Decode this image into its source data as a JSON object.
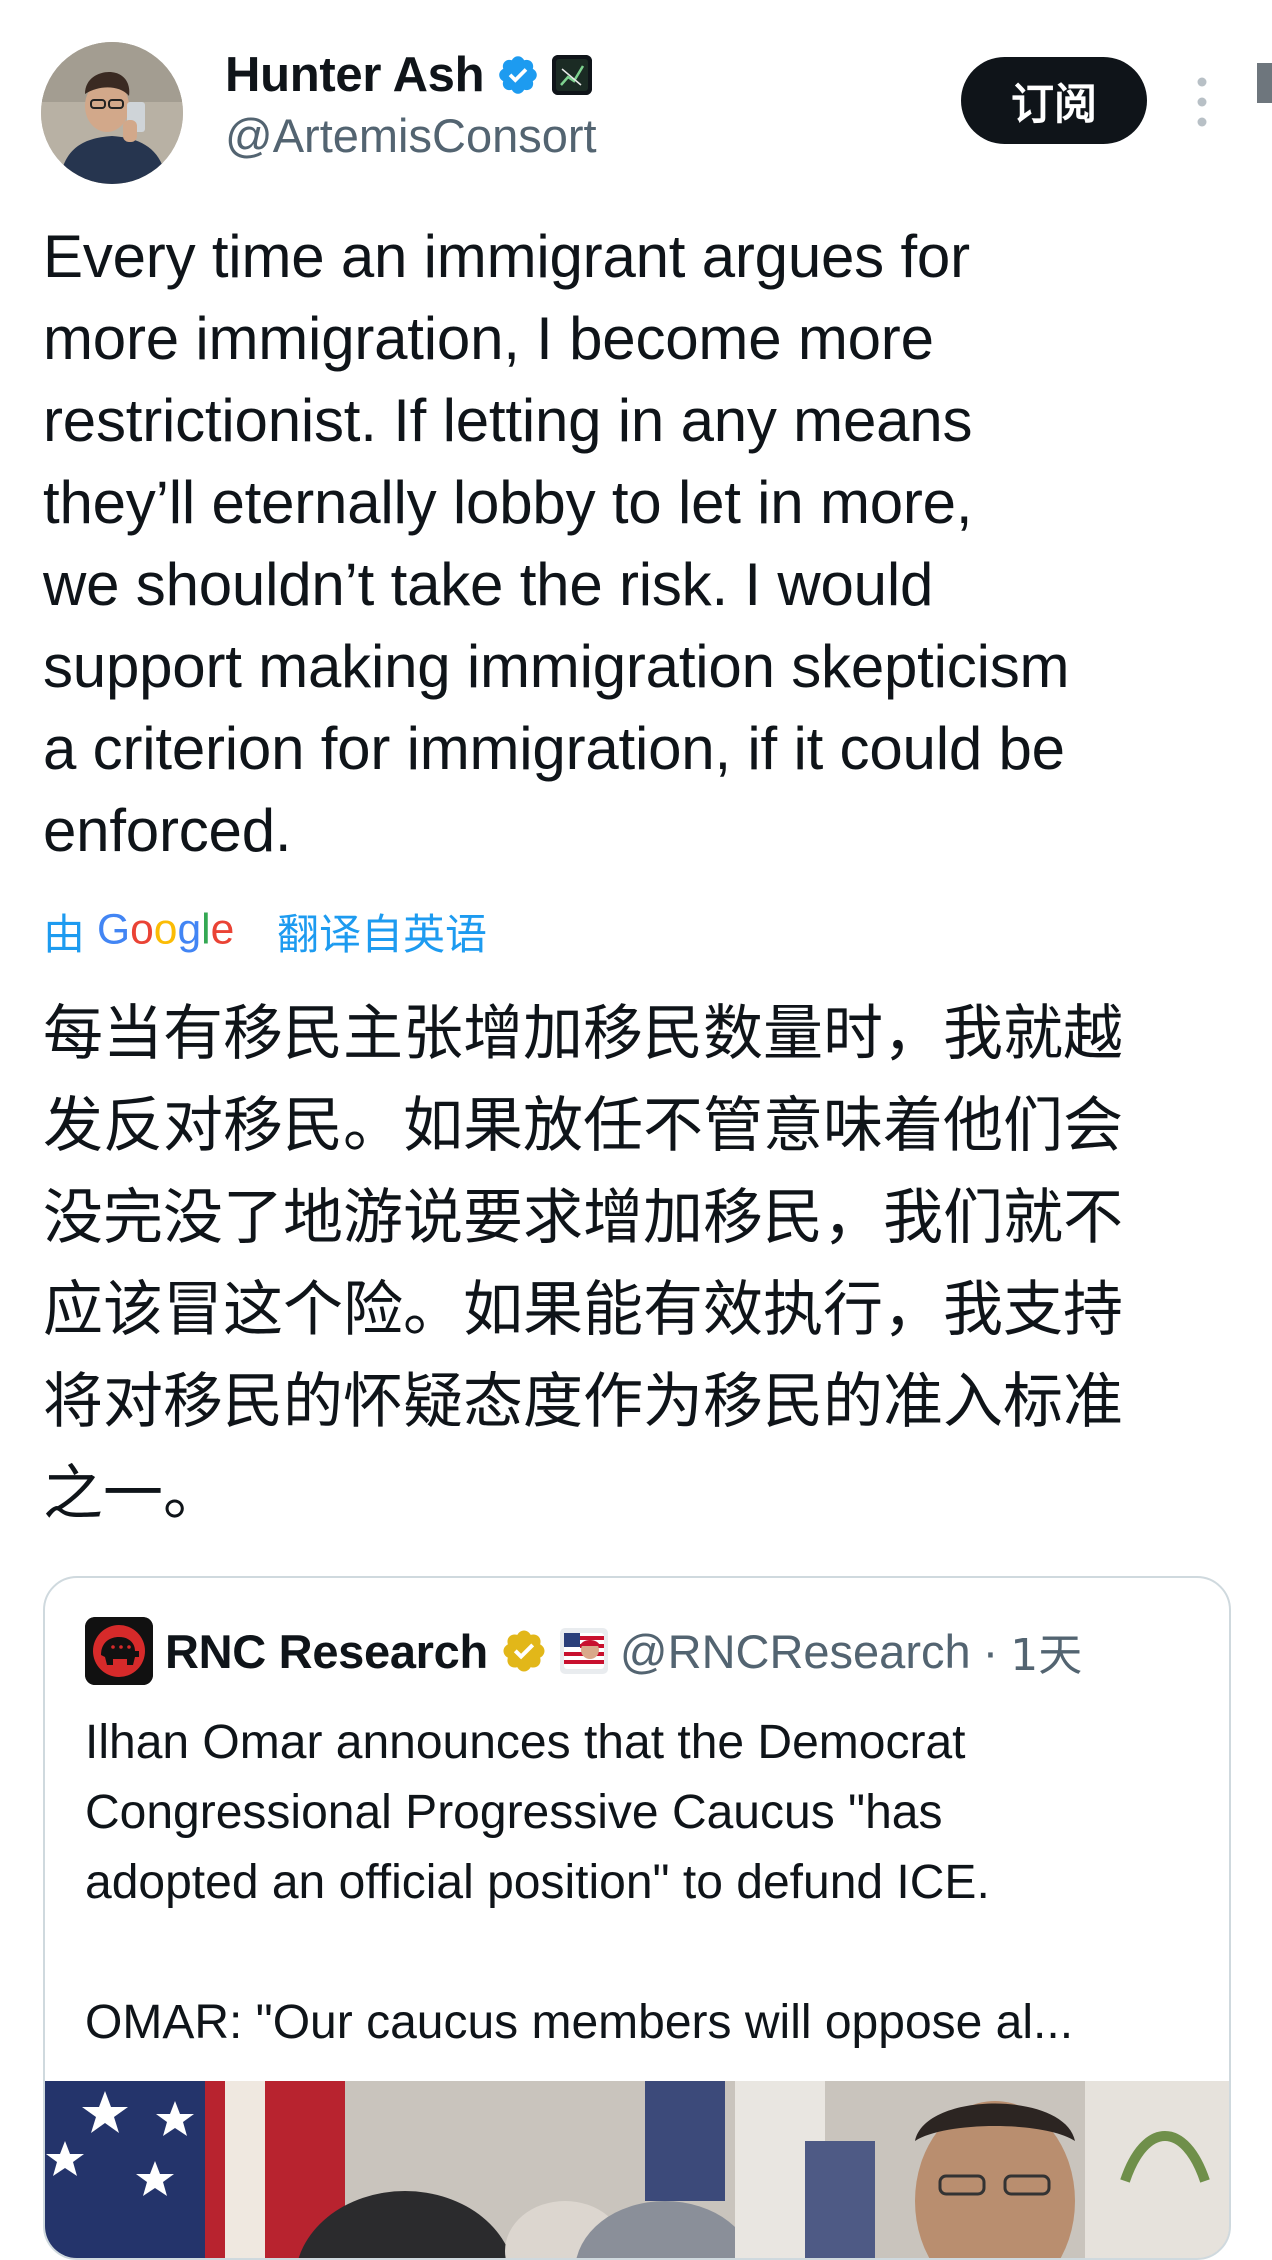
{
  "author": {
    "display_name": "Hunter Ash",
    "handle": "@ArtemisConsort",
    "verified": true
  },
  "header": {
    "subscribe_label": "订阅"
  },
  "tweet": {
    "text_lines": [
      "Every time an immigrant argues for",
      "more immigration, I become more",
      "restrictionist. If letting in any means",
      "they’ll eternally lobby to let in more,",
      "we shouldn’t take the risk. I would",
      "support making immigration skepticism",
      "a criterion for immigration, if it could be",
      "enforced."
    ],
    "translation": {
      "prefix": "由",
      "provider": "Google",
      "suffix": "翻译自英语"
    },
    "translated_lines": [
      "每当有移民主张增加移民数量时，我就越",
      "发反对移民。如果放任不管意味着他们会",
      "没完没了地游说要求增加移民，我们就不",
      "应该冒这个险。如果能有效执行，我支持",
      "将对移民的怀疑态度作为移民的准入标准",
      "之一。"
    ]
  },
  "quote": {
    "display_name": "RNC Research",
    "handle": "@RNCResearch",
    "separator": "·",
    "time": "1天",
    "text_lines": [
      "Ilhan Omar announces that the Democrat",
      "Congressional Progressive Caucus \"has",
      "adopted an official position\" to defund ICE.",
      "",
      "OMAR: \"Our caucus members will oppose al..."
    ]
  },
  "colors": {
    "link_blue": "#1d9bf0",
    "muted_text": "#536471",
    "verified_blue": "#1d9bf0",
    "verified_gold": "#e2b719",
    "button_bg": "#0f1419"
  },
  "icons": {
    "verified": "verified-badge-icon",
    "affiliate": "affiliate-badge-icon",
    "more": "more-vertical-icon",
    "gold_check": "gold-verified-badge-icon",
    "flag": "affiliate-flag-icon"
  }
}
